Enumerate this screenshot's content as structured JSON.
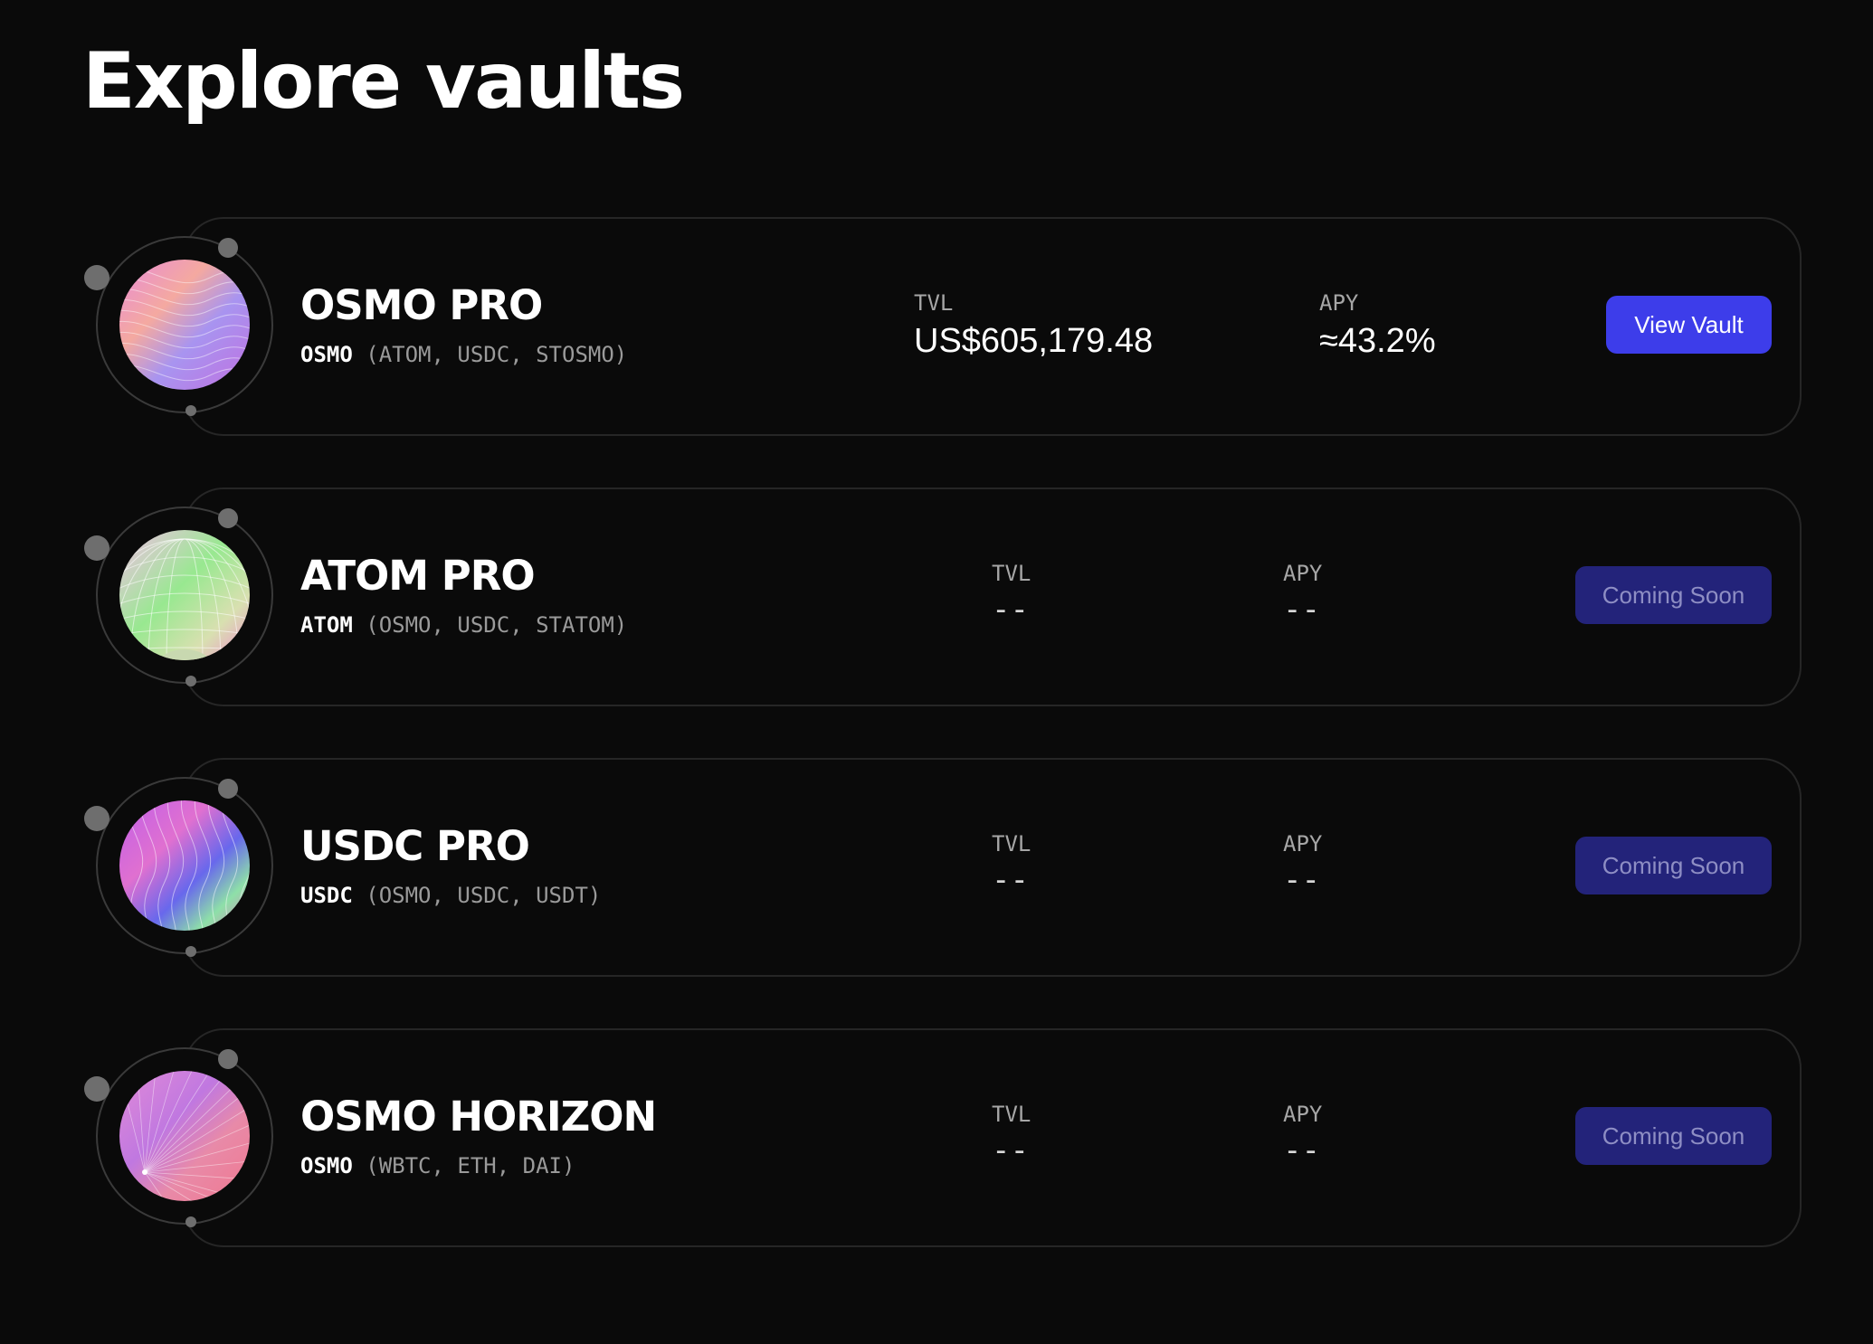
{
  "page": {
    "title": "Explore vaults"
  },
  "vaults": [
    {
      "name": "OSMO PRO",
      "base_asset": "OSMO",
      "assets": "(ATOM, USDC, STOSMO)",
      "tvl_label": "TVL",
      "tvl_value": "US$605,179.48",
      "apy_label": "APY",
      "apy_value": "≈43.2%",
      "action_label": "View Vault",
      "action_enabled": true,
      "art": "wave-gradient-pink-purple"
    },
    {
      "name": "ATOM PRO",
      "base_asset": "ATOM",
      "assets": "(OSMO, USDC, STATOM)",
      "tvl_label": "TVL",
      "tvl_value": "--",
      "apy_label": "APY",
      "apy_value": "--",
      "action_label": "Coming Soon",
      "action_enabled": false,
      "art": "grid-sphere-green-pink"
    },
    {
      "name": "USDC PRO",
      "base_asset": "USDC",
      "assets": "(OSMO, USDC, USDT)",
      "tvl_label": "TVL",
      "tvl_value": "--",
      "apy_label": "APY",
      "apy_value": "--",
      "action_label": "Coming Soon",
      "action_enabled": false,
      "art": "wave-gradient-purple-blue"
    },
    {
      "name": "OSMO HORIZON",
      "base_asset": "OSMO",
      "assets": "(WBTC, ETH, DAI)",
      "tvl_label": "TVL",
      "tvl_value": "--",
      "apy_label": "APY",
      "apy_value": "--",
      "action_label": "Coming Soon",
      "action_enabled": false,
      "art": "radial-rays-pink-purple"
    }
  ]
}
